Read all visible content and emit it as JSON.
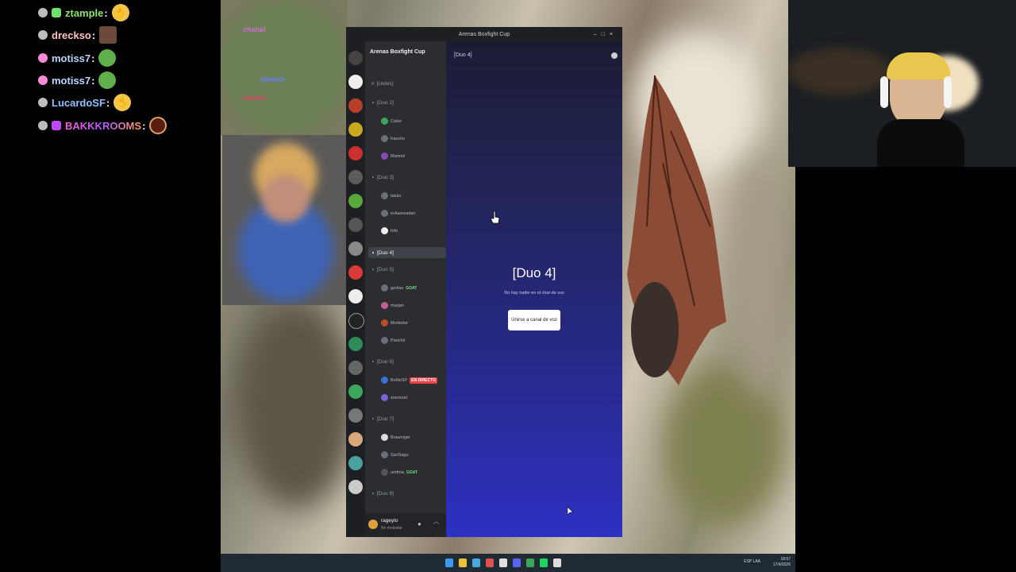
{
  "chat": {
    "messages": [
      {
        "user": "ztample",
        "sep": ":",
        "color": "#8ee36a",
        "dot": "gray"
      },
      {
        "user": "drecksо",
        "sep": ":",
        "color": "#ffb4b4",
        "dot": "gray"
      },
      {
        "user": "motiss7",
        "sep": ":",
        "color": "#a9d0ff",
        "dot": "pink"
      },
      {
        "user": "motiss7",
        "sep": ":",
        "color": "#a9d0ff",
        "dot": "pink"
      },
      {
        "user": "LucardoSF",
        "sep": ":",
        "color": "#7fb8ff",
        "dot": "gray"
      },
      {
        "user": "BAKKKROOMS",
        "sep": ":",
        "color": "#d04cff",
        "dot": "gray"
      }
    ]
  },
  "discord": {
    "window_title": "Arenas Boxfight Cup",
    "server_name": "Arenas Boxfight Cup",
    "header_channel": "[Duo 4]",
    "channels": [
      {
        "label": "[codes]",
        "kind": "text"
      },
      {
        "label": "[Duo 2]",
        "kind": "voice"
      },
      {
        "label": "[Duo 3]",
        "kind": "voice"
      },
      {
        "label": "[Duo 4]",
        "kind": "voice",
        "active": true
      },
      {
        "label": "[Duo 5]",
        "kind": "voice"
      },
      {
        "label": "[Duo 6]",
        "kind": "voice"
      },
      {
        "label": "[Duo 7]",
        "kind": "voice"
      },
      {
        "label": "[Duo 8]",
        "kind": "voice"
      }
    ],
    "voice_users": [
      {
        "name": "Colse",
        "badge": ""
      },
      {
        "name": "francho",
        "badge": ""
      },
      {
        "name": "Marmol",
        "badge": ""
      },
      {
        "name": "tatulo",
        "badge": ""
      },
      {
        "name": "evilaareadan",
        "badge": ""
      },
      {
        "name": "fofo",
        "badge": ""
      },
      {
        "name": "gorilax",
        "badge": "GOAT"
      },
      {
        "name": "marjan",
        "badge": ""
      },
      {
        "name": "Mortedor",
        "badge": ""
      },
      {
        "name": "Panchii",
        "badge": ""
      },
      {
        "name": "BnNeSP",
        "badge": "EN DIRECTO"
      },
      {
        "name": "zoemoal",
        "badge": ""
      },
      {
        "name": "Brawniger",
        "badge": ""
      },
      {
        "name": "SanSagu",
        "badge": ""
      },
      {
        "name": "umfma",
        "badge": "GOAT"
      }
    ],
    "user_panel": {
      "name": "rageylo",
      "status": "No molestar"
    },
    "main": {
      "title": "[Duo 4]",
      "subtitle": "No hay nadie en el chat de voz",
      "join_button": "Unirse a canal de voz"
    }
  },
  "overlay_alerts": [
    "chanel",
    "volveit",
    "dinerol"
  ],
  "taskbar": {
    "time": "18:57",
    "date": "17/4/2026",
    "lang": "ESP LAA"
  },
  "colors": {
    "discord_dark": "#1e1f22",
    "sidebar": "#2b2d31",
    "accent_blue": "#2d31c2",
    "live_red": "#ed4245",
    "goat_green": "#6ee07a"
  }
}
